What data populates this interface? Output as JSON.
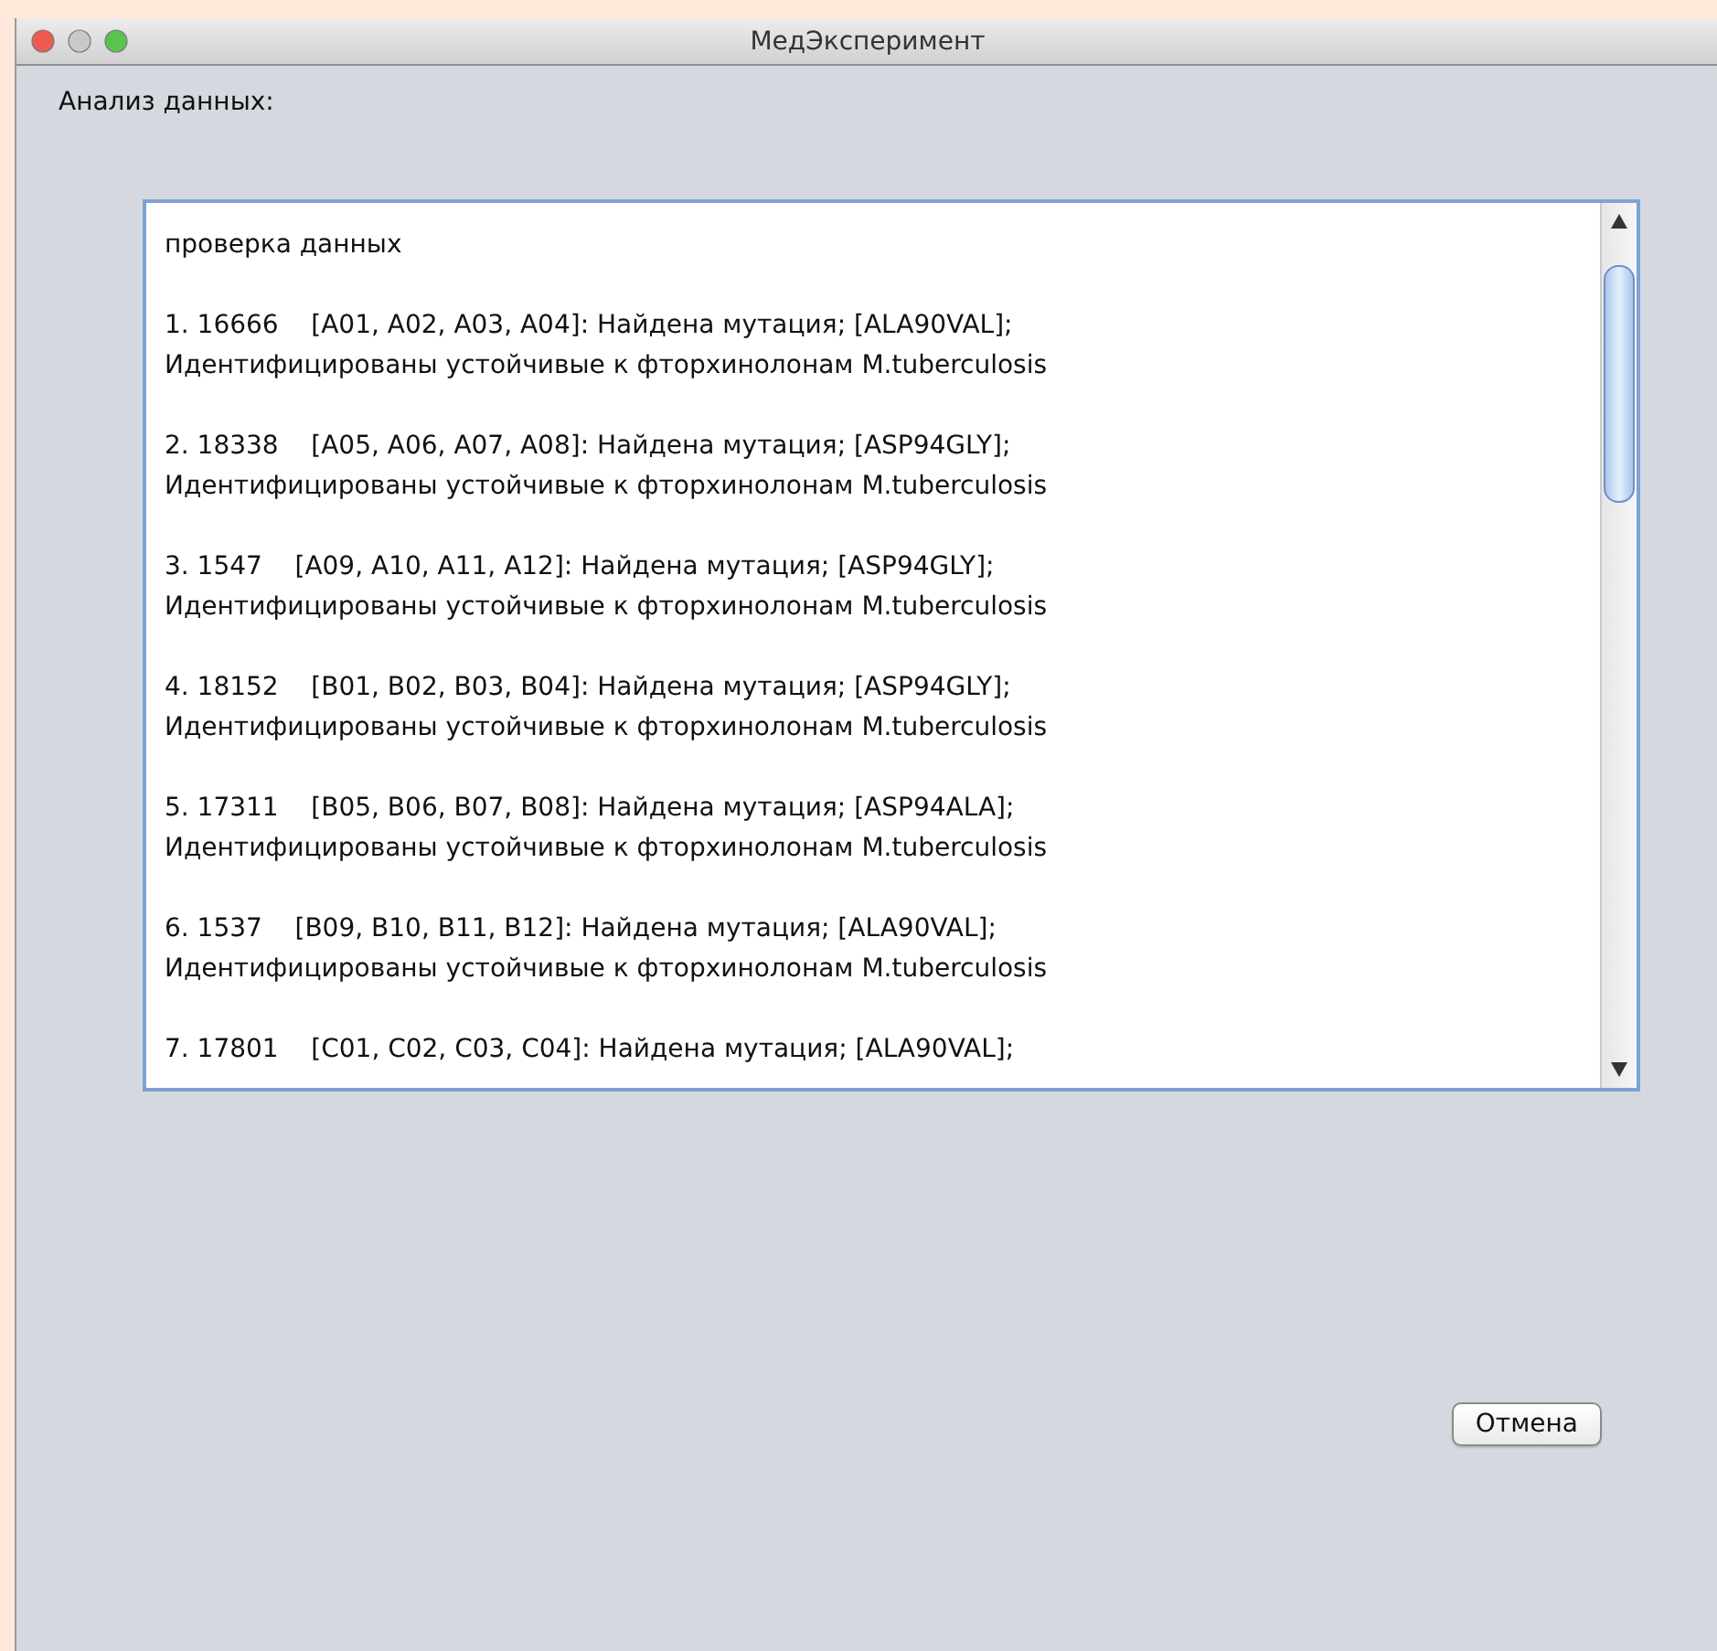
{
  "window": {
    "title": "МедЭксперимент"
  },
  "label": "Анализ данных:",
  "output": {
    "heading": "проверка данных",
    "entries": [
      {
        "line1": "1. 16666    [A01, A02, A03, A04]: Найдена мутация; [ALA90VAL];",
        "line2": "Идентифицированы устойчивые к фторхинолонам M.tuberculosis"
      },
      {
        "line1": "2. 18338    [A05, A06, A07, A08]: Найдена мутация; [ASP94GLY];",
        "line2": "Идентифицированы устойчивые к фторхинолонам M.tuberculosis"
      },
      {
        "line1": "3. 1547    [A09, A10, A11, A12]: Найдена мутация; [ASP94GLY];",
        "line2": "Идентифицированы устойчивые к фторхинолонам M.tuberculosis"
      },
      {
        "line1": "4. 18152    [B01, B02, B03, B04]: Найдена мутация; [ASP94GLY];",
        "line2": "Идентифицированы устойчивые к фторхинолонам M.tuberculosis"
      },
      {
        "line1": "5. 17311    [B05, B06, B07, B08]: Найдена мутация; [ASP94ALA];",
        "line2": "Идентифицированы устойчивые к фторхинолонам M.tuberculosis"
      },
      {
        "line1": "6. 1537    [B09, B10, B11, B12]: Найдена мутация; [ALA90VAL];",
        "line2": "Идентифицированы устойчивые к фторхинолонам M.tuberculosis"
      },
      {
        "line1": "7. 17801    [C01, C02, C03, C04]: Найдена мутация; [ALA90VAL];"
      }
    ]
  },
  "buttons": [
    {
      "label": "Отмена"
    }
  ]
}
